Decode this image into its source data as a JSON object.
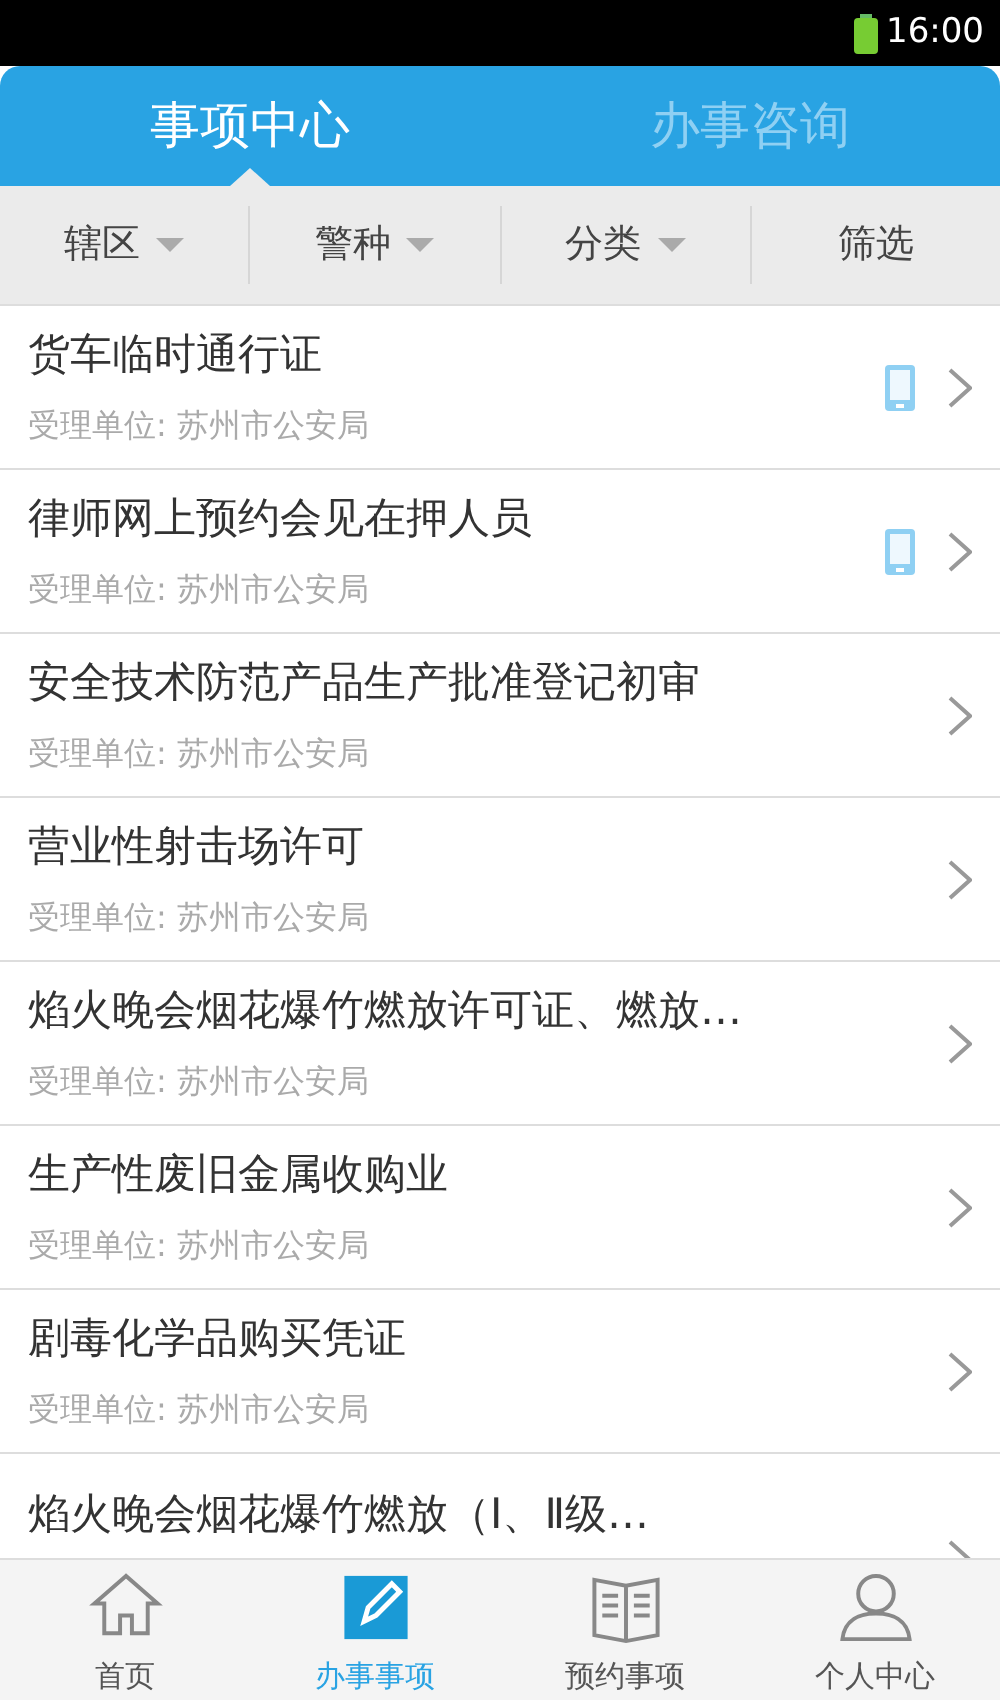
{
  "status_bar": {
    "time": "16:00"
  },
  "tabs": [
    {
      "label": "事项中心",
      "selected": true
    },
    {
      "label": "办事咨询",
      "selected": false
    }
  ],
  "filters": [
    {
      "label": "辖区",
      "kind": "dropdown"
    },
    {
      "label": "警种",
      "kind": "dropdown"
    },
    {
      "label": "分类",
      "kind": "dropdown"
    },
    {
      "label": "筛选",
      "kind": "plain"
    }
  ],
  "items": [
    {
      "title": "货车临时通行证",
      "subtitle": "受理单位: 苏州市公安局",
      "mobile": true
    },
    {
      "title": "律师网上预约会见在押人员",
      "subtitle": "受理单位: 苏州市公安局",
      "mobile": true
    },
    {
      "title": "安全技术防范产品生产批准登记初审",
      "subtitle": "受理单位: 苏州市公安局",
      "mobile": false
    },
    {
      "title": "营业性射击场许可",
      "subtitle": "受理单位: 苏州市公安局",
      "mobile": false
    },
    {
      "title": "焰火晚会烟花爆竹燃放许可证、燃放…",
      "subtitle": "受理单位: 苏州市公安局",
      "mobile": false
    },
    {
      "title": "生产性废旧金属收购业",
      "subtitle": "受理单位: 苏州市公安局",
      "mobile": false
    },
    {
      "title": "剧毒化学品购买凭证",
      "subtitle": "受理单位: 苏州市公安局",
      "mobile": false
    },
    {
      "title": "焰火晚会烟花爆竹燃放（Ⅰ、Ⅱ级…",
      "mobile": false
    }
  ],
  "bottom_nav": [
    {
      "label": "首页",
      "kind": "home",
      "selected": false
    },
    {
      "label": "办事事项",
      "kind": "edit",
      "selected": true
    },
    {
      "label": "预约事项",
      "kind": "book",
      "selected": false
    },
    {
      "label": "个人中心",
      "kind": "person",
      "selected": false
    }
  ]
}
